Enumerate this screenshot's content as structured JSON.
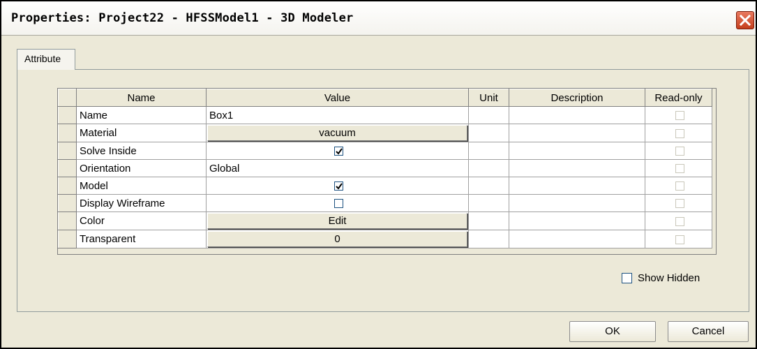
{
  "window": {
    "title": "Properties: Project22 - HFSSModel1 - 3D Modeler"
  },
  "tabs": [
    {
      "label": "Attribute"
    }
  ],
  "table": {
    "columns": [
      "Name",
      "Value",
      "Unit",
      "Description",
      "Read-only"
    ],
    "rows": [
      {
        "name": "Name",
        "value": "Box1",
        "value_type": "text",
        "checked": false
      },
      {
        "name": "Material",
        "value": "vacuum",
        "value_type": "button",
        "checked": false
      },
      {
        "name": "Solve Inside",
        "value": "",
        "value_type": "checkbox",
        "checked": true
      },
      {
        "name": "Orientation",
        "value": "Global",
        "value_type": "text",
        "checked": false
      },
      {
        "name": "Model",
        "value": "",
        "value_type": "checkbox",
        "checked": true
      },
      {
        "name": "Display Wireframe",
        "value": "",
        "value_type": "checkbox",
        "checked": false
      },
      {
        "name": "Color",
        "value": "Edit",
        "value_type": "button",
        "checked": false
      },
      {
        "name": "Transparent",
        "value": "0",
        "value_type": "button",
        "checked": false
      }
    ]
  },
  "options": {
    "show_hidden_label": "Show Hidden",
    "show_hidden_checked": false
  },
  "buttons": {
    "ok_label": "OK",
    "cancel_label": "Cancel"
  },
  "icons": {
    "close": "close-icon",
    "check": "checkmark-icon"
  },
  "colors": {
    "dialog_bg": "#ece9d8",
    "close_button": "#d2532f"
  }
}
